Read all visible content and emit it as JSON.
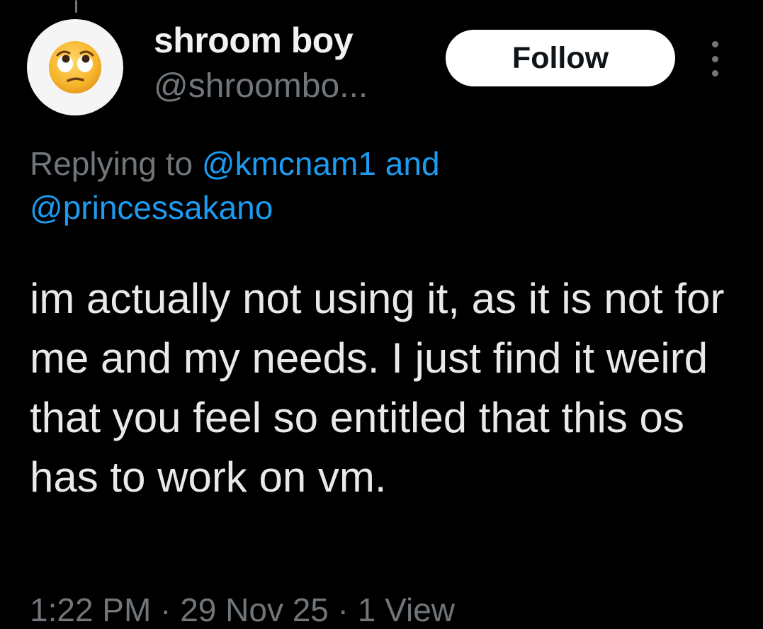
{
  "author": {
    "display_name": "shroom boy",
    "handle": "@shroombo...",
    "avatar_emoji": "face-with-rolling-eyes"
  },
  "actions": {
    "follow_label": "Follow",
    "more_icon": "more-vertical-icon"
  },
  "reply": {
    "prefix": "Replying to ",
    "mention_1": "@kmcnam1",
    "conjunction": " and ",
    "mention_2": "@princessakano"
  },
  "tweet": {
    "text": "im actually not using it, as it is not for me and my needs. I just find it weird that you feel so entitled that this os has to work on vm."
  },
  "meta": {
    "partial": "1:22 PM · 29 Nov 25 · 1 View"
  },
  "colors": {
    "background": "#000000",
    "text": "#e7e9ea",
    "secondary": "#71767b",
    "accent": "#1d9bf0",
    "follow_bg": "#ffffff"
  }
}
